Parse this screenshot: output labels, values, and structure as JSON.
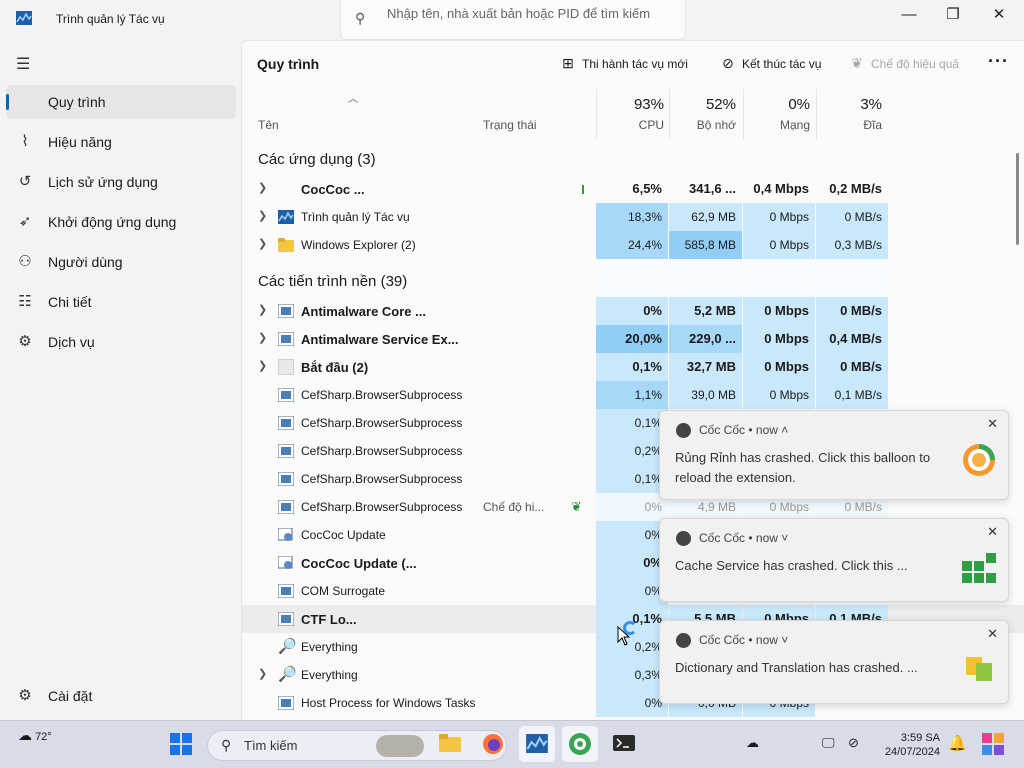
{
  "window": {
    "title": "Trình quản lý Tác vụ",
    "search_placeholder": "Nhập tên, nhà xuất bản hoặc PID để tìm kiếm"
  },
  "sidebar": {
    "items": [
      {
        "label": "Quy trình",
        "icon": "processes-icon",
        "active": true
      },
      {
        "label": "Hiệu năng",
        "icon": "performance-icon"
      },
      {
        "label": "Lịch sử ứng dụng",
        "icon": "history-icon"
      },
      {
        "label": "Khởi động ứng dụng",
        "icon": "startup-icon"
      },
      {
        "label": "Người dùng",
        "icon": "users-icon"
      },
      {
        "label": "Chi tiết",
        "icon": "details-icon"
      },
      {
        "label": "Dịch vụ",
        "icon": "services-icon"
      }
    ],
    "settings_label": "Cài đặt"
  },
  "main": {
    "title": "Quy trình",
    "toolbar": {
      "new_task": "Thi hành tác vụ mới",
      "end_task": "Kết thúc tác vụ",
      "efficiency": "Chế độ hiệu quả"
    },
    "columns": {
      "name": "Tên",
      "status": "Trạng thái",
      "cpu_pct": "93%",
      "cpu": "CPU",
      "mem_pct": "52%",
      "mem": "Bộ nhớ",
      "net_pct": "0%",
      "net": "Mạng",
      "disk_pct": "3%",
      "disk": "Đĩa"
    },
    "groups": {
      "apps": "Các ứng dụng (3)",
      "background": "Các tiến trình nền (39)"
    },
    "rows": [
      {
        "name": "CocCoc ...",
        "cpu": "6,5%",
        "mem": "341,6 ...",
        "net": "0,4 Mbps",
        "disk": "0,2 MB/s",
        "status": ""
      },
      {
        "name": "Trình quản lý Tác vụ",
        "cpu": "18,3%",
        "mem": "62,9 MB",
        "net": "0 Mbps",
        "disk": "0 MB/s",
        "status": ""
      },
      {
        "name": "Windows Explorer (2)",
        "cpu": "24,4%",
        "mem": "585,8 MB",
        "net": "0 Mbps",
        "disk": "0,3 MB/s",
        "status": ""
      },
      {
        "name": "Antimalware Core ...",
        "cpu": "0%",
        "mem": "5,2 MB",
        "net": "0 Mbps",
        "disk": "0 MB/s",
        "status": ""
      },
      {
        "name": "Antimalware Service Ex...",
        "cpu": "20,0%",
        "mem": "229,0 ...",
        "net": "0 Mbps",
        "disk": "0,4 MB/s",
        "status": ""
      },
      {
        "name": "Bắt đầu (2)",
        "cpu": "0,1%",
        "mem": "32,7 MB",
        "net": "0 Mbps",
        "disk": "0 MB/s",
        "status": ""
      },
      {
        "name": "CefSharp.BrowserSubprocess",
        "cpu": "1,1%",
        "mem": "39,0 MB",
        "net": "0 Mbps",
        "disk": "0,1 MB/s",
        "status": ""
      },
      {
        "name": "CefSharp.BrowserSubprocess",
        "cpu": "0,1%",
        "mem": "",
        "net": "",
        "disk": "",
        "status": ""
      },
      {
        "name": "CefSharp.BrowserSubprocess",
        "cpu": "0,2%",
        "mem": "",
        "net": "",
        "disk": "",
        "status": ""
      },
      {
        "name": "CefSharp.BrowserSubprocess",
        "cpu": "0,1%",
        "mem": "",
        "net": "",
        "disk": "",
        "status": ""
      },
      {
        "name": "CefSharp.BrowserSubprocess",
        "cpu": "0%",
        "mem": "4,9 MB",
        "net": "0 Mbps",
        "disk": "0 MB/s",
        "status": "Chế độ hi..."
      },
      {
        "name": "CocCoc Update",
        "cpu": "0%",
        "mem": "",
        "net": "",
        "disk": "",
        "status": ""
      },
      {
        "name": "CocCoc Update (...",
        "cpu": "0%",
        "mem": "",
        "net": "",
        "disk": "",
        "status": ""
      },
      {
        "name": "COM Surrogate",
        "cpu": "0%",
        "mem": "",
        "net": "",
        "disk": "",
        "status": ""
      },
      {
        "name": "CTF Lo...",
        "cpu": "0,1%",
        "mem": "5,5 MB",
        "net": "0 Mbps",
        "disk": "0,1 MB/s",
        "status": ""
      },
      {
        "name": "Everything",
        "cpu": "0,2%",
        "mem": "",
        "net": "",
        "disk": "",
        "status": ""
      },
      {
        "name": "Everything",
        "cpu": "0,3%",
        "mem": "",
        "net": "",
        "disk": "",
        "status": ""
      },
      {
        "name": "Host Process for Windows Tasks",
        "cpu": "0%",
        "mem": "0,0 MB",
        "net": "0 Mbps",
        "disk": "",
        "status": ""
      }
    ]
  },
  "notifications": [
    {
      "app": "Cốc Cốc",
      "time": "now",
      "message": "Rủng Rỉnh has crashed. Click this balloon to reload the extension."
    },
    {
      "app": "Cốc Cốc",
      "time": "now",
      "message": "Cache Service has crashed. Click this ..."
    },
    {
      "app": "Cốc Cốc",
      "time": "now",
      "message": "Dictionary and Translation has crashed. ..."
    }
  ],
  "taskbar": {
    "weather": "72°",
    "search_label": "Tìm kiếm",
    "time": "3:59 SA",
    "date": "24/07/2024"
  },
  "colors": {
    "accent": "#0067c0",
    "heat_light": "#c9e8fb",
    "heat_mid": "#a8d8f7",
    "heat_strong": "#91cdf5"
  }
}
